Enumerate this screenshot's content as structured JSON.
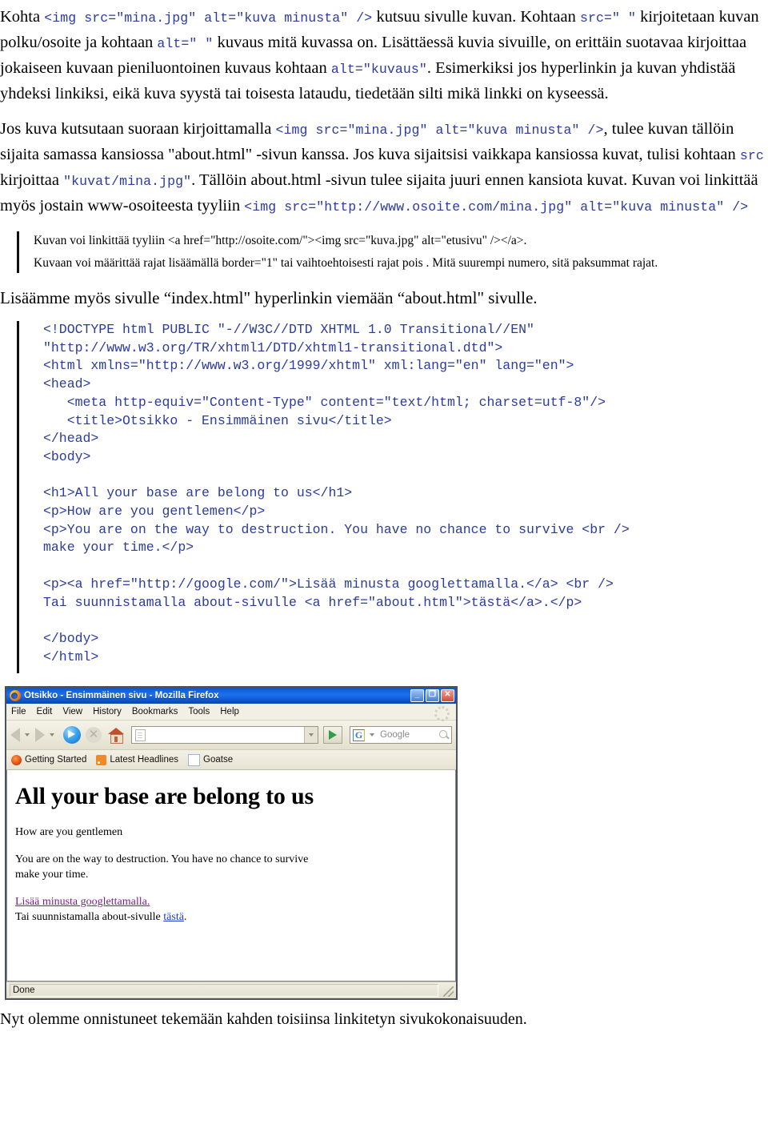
{
  "document": {
    "paragraphs": [
      {
        "id": "p1",
        "runs": [
          {
            "t": "Kohta ",
            "k": "text"
          },
          {
            "t": "<img src=\"mina.jpg\" alt=\"kuva minusta\" />",
            "k": "code"
          },
          {
            "t": " kutsuu sivulle kuvan. Kohtaan ",
            "k": "text"
          },
          {
            "t": "src=\" \"",
            "k": "code"
          },
          {
            "t": " kirjoitetaan kuvan polku/osoite ja kohtaan ",
            "k": "text"
          },
          {
            "t": "alt=\" \"",
            "k": "code"
          },
          {
            "t": " kuvaus mitä kuvassa on. Lisättäessä kuvia sivuille, on erittäin suotavaa kirjoittaa jokaiseen kuvaan pieniluontoinen kuvaus kohtaan ",
            "k": "text"
          },
          {
            "t": "alt=\"kuvaus\"",
            "k": "code"
          },
          {
            "t": ". Esimerkiksi jos hyperlinkin ja kuvan yhdistää yhdeksi linkiksi, eikä kuva syystä tai toisesta lataudu, tiedetään silti mikä linkki on kyseessä.",
            "k": "text"
          }
        ]
      },
      {
        "id": "p2",
        "runs": [
          {
            "t": "Jos kuva kutsutaan suoraan kirjoittamalla ",
            "k": "text"
          },
          {
            "t": "<img src=\"mina.jpg\" alt=\"kuva minusta\" />",
            "k": "code"
          },
          {
            "t": ", tulee kuvan tällöin sijaita samassa kansiossa \"about.html\" -sivun kanssa. Jos kuva sijaitsisi vaikkapa kansiossa kuvat, tulisi kohtaan ",
            "k": "text"
          },
          {
            "t": "src",
            "k": "code"
          },
          {
            "t": " kirjoittaa ",
            "k": "text"
          },
          {
            "t": "\"kuvat/mina.jpg\"",
            "k": "code"
          },
          {
            "t": ". Tällöin about.html -sivun tulee sijaita juuri ennen kansiota kuvat. Kuvan voi linkittää myös jostain www-osoiteesta tyyliin ",
            "k": "text"
          },
          {
            "t": "<img src=\"http://www.osoite.com/mina.jpg\" alt=\"kuva minusta\" />",
            "k": "code"
          }
        ]
      }
    ],
    "quote_block": {
      "lines": [
        "Kuvan voi linkittää tyyliin <a href=\"http://osoite.com/\"><img src=\"kuva.jpg\" alt=\"etusivu\" /></a>.",
        "Kuvaan voi määrittää rajat lisäämällä border=\"1\" tai vaihtoehtoisesti rajat pois . Mitä suurempi numero, sitä paksummat rajat."
      ]
    },
    "headline": "Lisäämme myös sivulle “index.html\" hyperlinkin viemään “about.html\" sivulle.",
    "code_listing": "<!DOCTYPE html PUBLIC \"-//W3C//DTD XHTML 1.0 Transitional//EN\"\n\"http://www.w3.org/TR/xhtml1/DTD/xhtml1-transitional.dtd\">\n<html xmlns=\"http://www.w3.org/1999/xhtml\" xml:lang=\"en\" lang=\"en\">\n<head>\n   <meta http-equiv=\"Content-Type\" content=\"text/html; charset=utf-8\"/>\n   <title>Otsikko - Ensimmäinen sivu</title>\n</head>\n<body>\n\n<h1>All your base are belong to us</h1>\n<p>How are you gentlemen</p>\n<p>You are on the way to destruction. You have no chance to survive <br />\nmake your time.</p>\n\n<p><a href=\"http://google.com/\">Lisää minusta googlettamalla.</a> <br />\nTai suunnistamalla about-sivulle <a href=\"about.html\">tästä</a>.</p>\n\n</body>\n</html>",
    "closing": "Nyt olemme onnistuneet tekemään kahden toisiinsa linkitetyn sivukokonaisuuden."
  },
  "browser": {
    "title": "Otsikko - Ensimmäinen sivu - Mozilla Firefox",
    "window_buttons": {
      "minimize": "_",
      "maximize": "❐",
      "close": "✕"
    },
    "menu": [
      "File",
      "Edit",
      "View",
      "History",
      "Bookmarks",
      "Tools",
      "Help"
    ],
    "address": {
      "value": "",
      "placeholder": ""
    },
    "search": {
      "value": "",
      "placeholder": "Google",
      "engine": "G"
    },
    "bookmarks": [
      {
        "label": "Getting Started",
        "icon": "firefox-icon"
      },
      {
        "label": "Latest Headlines",
        "icon": "rss-icon"
      },
      {
        "label": "Goatse",
        "icon": "document-icon"
      }
    ],
    "page": {
      "h1": "All your base are belong to us",
      "p1": "How are you gentlemen",
      "p2_line1": "You are on the way to destruction. You have no chance to survive",
      "p2_line2": "make your time.",
      "link1": "Lisää minusta googlettamalla.",
      "p3_prefix": "Tai suunnistamalla about-sivulle ",
      "link2": "tästä",
      "p3_suffix": "."
    },
    "status": "Done"
  },
  "colors": {
    "code_blue": "#2b3b9e",
    "titlebar_blue": "#1263dd",
    "link_visited": "#7a1f8c",
    "link_unvisited": "#1a3fd0",
    "chrome_bg": "#ece9d8"
  }
}
